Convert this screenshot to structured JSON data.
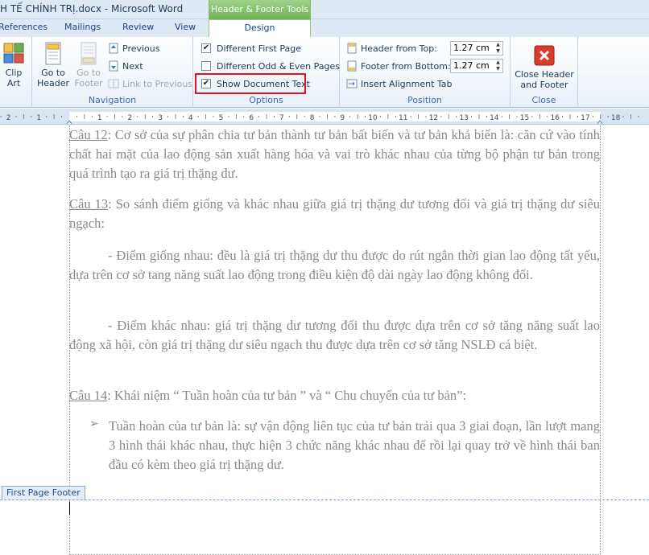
{
  "window": {
    "title": "H TẾ CHÍNH TRỊ.docx - Microsoft Word",
    "contextual_tab_group": "Header & Footer Tools"
  },
  "tabs": [
    {
      "label": "References"
    },
    {
      "label": "Mailings"
    },
    {
      "label": "Review"
    },
    {
      "label": "View"
    }
  ],
  "active_tab": "Design",
  "ribbon": {
    "clip_art": {
      "label_line1": "Clip",
      "label_line2": "Art"
    },
    "navigation": {
      "group_label": "Navigation",
      "go_to_header": {
        "line1": "Go to",
        "line2": "Header"
      },
      "go_to_footer": {
        "line1": "Go to",
        "line2": "Footer"
      },
      "previous": "Previous",
      "next": "Next",
      "link_to_previous": "Link to Previous"
    },
    "options": {
      "group_label": "Options",
      "different_first_page": {
        "label": "Different First Page",
        "checked": "✔"
      },
      "different_odd_even": {
        "label": "Different Odd & Even Pages",
        "checked": ""
      },
      "show_document_text": {
        "label": "Show Document Text",
        "checked": "✔"
      }
    },
    "position": {
      "group_label": "Position",
      "header_from_top": {
        "label": "Header from Top:",
        "value": "1.27 cm"
      },
      "footer_from_bottom": {
        "label": "Footer from Bottom:",
        "value": "1.27 cm"
      },
      "insert_alignment_tab": "Insert Alignment Tab"
    },
    "close": {
      "group_label": "Close",
      "line1": "Close Header",
      "line2": "and Footer"
    }
  },
  "ruler": {
    "ticks": [
      "2",
      "1",
      "1",
      "2",
      "3",
      "4",
      "5",
      "6",
      "7",
      "8",
      "9",
      "10",
      "11",
      "12",
      "13",
      "14",
      "15",
      "16",
      "17",
      "18"
    ]
  },
  "document": {
    "p12": {
      "label": "Câu 12",
      "text": ": Cơ sở của sự phân chia tư bản thành tư bản bất biến và tư bản khả biến là: căn cứ vào tính chất hai mặt của lao động sản xuất hàng hóa và vai trò khác nhau của từng bộ phận tư bản trong quá trình tạo ra giá trị thặng dư."
    },
    "p13": {
      "label": "Câu 13",
      "text": ": So sánh điểm giống và khác nhau giữa giá trị thặng dư tương đối và giá trị thặng dư siêu ngạch:"
    },
    "p13a": "- Điểm giống nhau: đều là giá trị thặng dư thu được do rút ngắn thời gian lao động tất yếu, dựa trên cơ sở tang năng suất lao động trong điều kiện độ dài ngày lao động không đổi.",
    "p13b": "- Điểm khác nhau: giá trị thặng dư tương đối thu được dựa trên cơ sở tăng năng suất lao động xã hội, còn giá trị thặng dư siêu ngạch thu được dựa trên cơ sở tăng NSLĐ cá biệt.",
    "p14": {
      "label": "Câu 14",
      "text": ": Khái niệm “ Tuần hoàn của tư bản ” và “ Chu chuyển của tư bản”:"
    },
    "bullet_glyph": "➢",
    "p14a": "Tuần hoàn của tư bản là: sự vận động liên tục của tư bản trải qua 3  giai đoạn, lần lượt mang 3 hình thái khác nhau, thực hiện 3 chức năng khác nhau để rồi lại quay trở về hình thái ban đầu có kèm theo giá trị thặng dư."
  },
  "footer_tab_label": "First Page Footer"
}
